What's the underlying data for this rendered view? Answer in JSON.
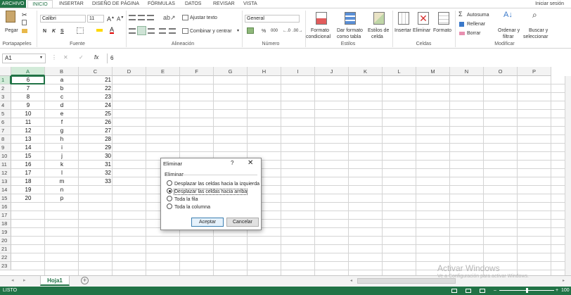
{
  "ribbon_tabs": [
    "ARCHIVO",
    "INICIO",
    "INSERTAR",
    "DISEÑO DE PÁGINA",
    "FÓRMULAS",
    "DATOS",
    "REVISAR",
    "VISTA"
  ],
  "signin": "Iniciar sesión",
  "clipboard": {
    "paste": "Pegar",
    "label": "Portapapeles"
  },
  "font": {
    "name": "Calibri",
    "size": "11",
    "bold": "N",
    "italic": "K",
    "underline": "S",
    "label": "Fuente"
  },
  "alignment": {
    "wrap": "Ajustar texto",
    "merge": "Combinar y centrar",
    "label": "Alineación"
  },
  "number": {
    "format": "General",
    "percent": "%",
    "thousands": "000",
    "label": "Número"
  },
  "styles": {
    "conditional": [
      "Formato",
      "condicional"
    ],
    "table": [
      "Dar formato",
      "como tabla"
    ],
    "cell": [
      "Estilos de",
      "celda"
    ],
    "label": "Estilos"
  },
  "cells": {
    "insert": "Insertar",
    "delete": "Eliminar",
    "format": "Formato",
    "label": "Celdas"
  },
  "editing": {
    "autosum": "Autosuma",
    "fill": "Rellenar",
    "clear": "Borrar",
    "sort": [
      "Ordenar y",
      "filtrar"
    ],
    "find": [
      "Buscar y",
      "seleccionar"
    ],
    "label": "Modificar"
  },
  "formula_bar": {
    "name_box": "A1",
    "fx": "fx",
    "value": "6"
  },
  "columns": [
    "A",
    "B",
    "C",
    "D",
    "E",
    "F",
    "G",
    "H",
    "I",
    "J",
    "K",
    "L",
    "M",
    "N",
    "O",
    "P"
  ],
  "rows": [
    "1",
    "2",
    "3",
    "4",
    "5",
    "6",
    "7",
    "8",
    "9",
    "10",
    "11",
    "12",
    "13",
    "14",
    "15",
    "16",
    "17",
    "18",
    "19",
    "20",
    "21",
    "22",
    "23"
  ],
  "col_a": [
    "6",
    "7",
    "8",
    "9",
    "10",
    "11",
    "12",
    "13",
    "14",
    "15",
    "16",
    "17",
    "18",
    "19",
    "20"
  ],
  "col_b": [
    "a",
    "b",
    "c",
    "d",
    "e",
    "f",
    "g",
    "h",
    "i",
    "j",
    "k",
    "l",
    "m",
    "n",
    "p"
  ],
  "col_c": [
    "21",
    "22",
    "23",
    "24",
    "25",
    "26",
    "27",
    "28",
    "29",
    "30",
    "31",
    "32",
    "33"
  ],
  "sheet_tab": "Hoja1",
  "status": {
    "mode": "LISTO",
    "zoom": "100"
  },
  "dialog": {
    "title": "Eliminar",
    "help": "?",
    "close": "✕",
    "group": "Eliminar",
    "options": [
      "Desplazar las celdas hacia la izquierda",
      "Desplazar las celdas hacia arriba",
      "Toda la fila",
      "Toda la columna"
    ],
    "selected_option": "Desplazar las celdas hacia arriba",
    "ok": "Aceptar",
    "cancel": "Cancelar"
  },
  "watermark": {
    "title": "Activar Windows",
    "subtitle": "Ve a Configuración para activar Windows."
  },
  "colors": {
    "accent": "#217346",
    "header_sel": "#d3ebd9",
    "grid_line": "#d4d4d4"
  }
}
